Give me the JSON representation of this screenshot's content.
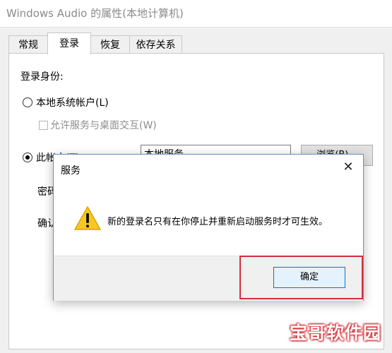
{
  "window": {
    "title": "Windows Audio 的属性(本地计算机)",
    "tabs": [
      {
        "label": "常规"
      },
      {
        "label": "登录"
      },
      {
        "label": "恢复"
      },
      {
        "label": "依存关系"
      }
    ],
    "active_tab": "登录"
  },
  "logon": {
    "section_label": "登录身份:",
    "local_system_label": "本地系统帐户(L)",
    "local_system_selected": false,
    "interact_desktop_label": "允许服务与桌面交互(W)",
    "interact_desktop_checked": false,
    "this_account_label": "此帐户(T):",
    "this_account_selected": true,
    "account_value": "本地服务",
    "browse_label": "浏览(B)...",
    "password_label": "密码",
    "confirm_label": "确认"
  },
  "dialog": {
    "title": "服务",
    "close_icon": "close-icon",
    "icon": "warning-icon",
    "message": "新的登录名只有在你停止并重新启动服务时才可生效。",
    "ok_label": "确定"
  },
  "colors": {
    "highlight_box": "#d32f3a",
    "ok_border": "#0078d7"
  },
  "watermark": {
    "text": "宝哥软件园"
  }
}
